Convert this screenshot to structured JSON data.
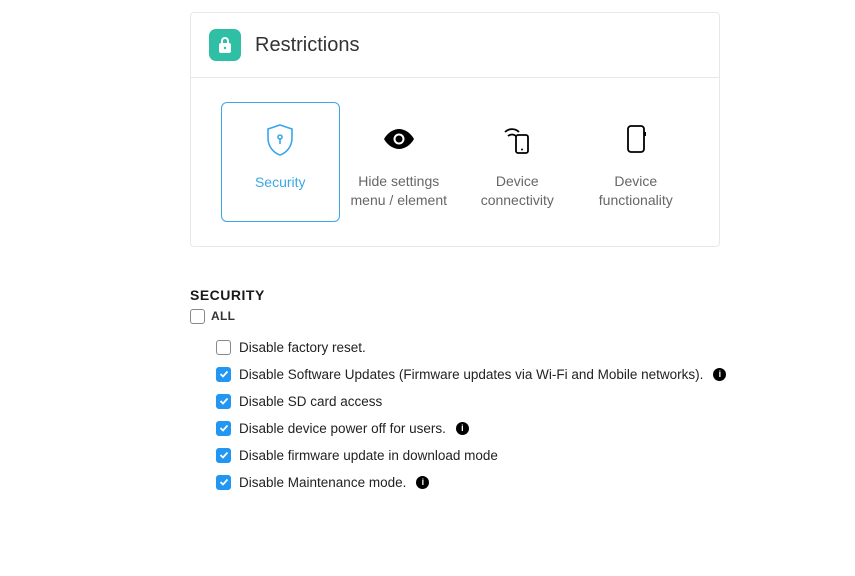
{
  "header": {
    "title": "Restrictions"
  },
  "tabs": [
    {
      "label": "Security"
    },
    {
      "label": "Hide settings menu / element"
    },
    {
      "label": "Device connectivity"
    },
    {
      "label": "Device functionality"
    }
  ],
  "section": {
    "title": "SECURITY",
    "all_label": "ALL",
    "options": [
      {
        "label": "Disable factory reset.",
        "checked": false,
        "info": false
      },
      {
        "label": "Disable Software Updates (Firmware updates via Wi-Fi and Mobile networks).",
        "checked": true,
        "info": true
      },
      {
        "label": "Disable SD card access",
        "checked": true,
        "info": false
      },
      {
        "label": "Disable device power off for users.",
        "checked": true,
        "info": true
      },
      {
        "label": "Disable firmware update in download mode",
        "checked": true,
        "info": false
      },
      {
        "label": "Disable Maintenance mode.",
        "checked": true,
        "info": true
      }
    ]
  }
}
